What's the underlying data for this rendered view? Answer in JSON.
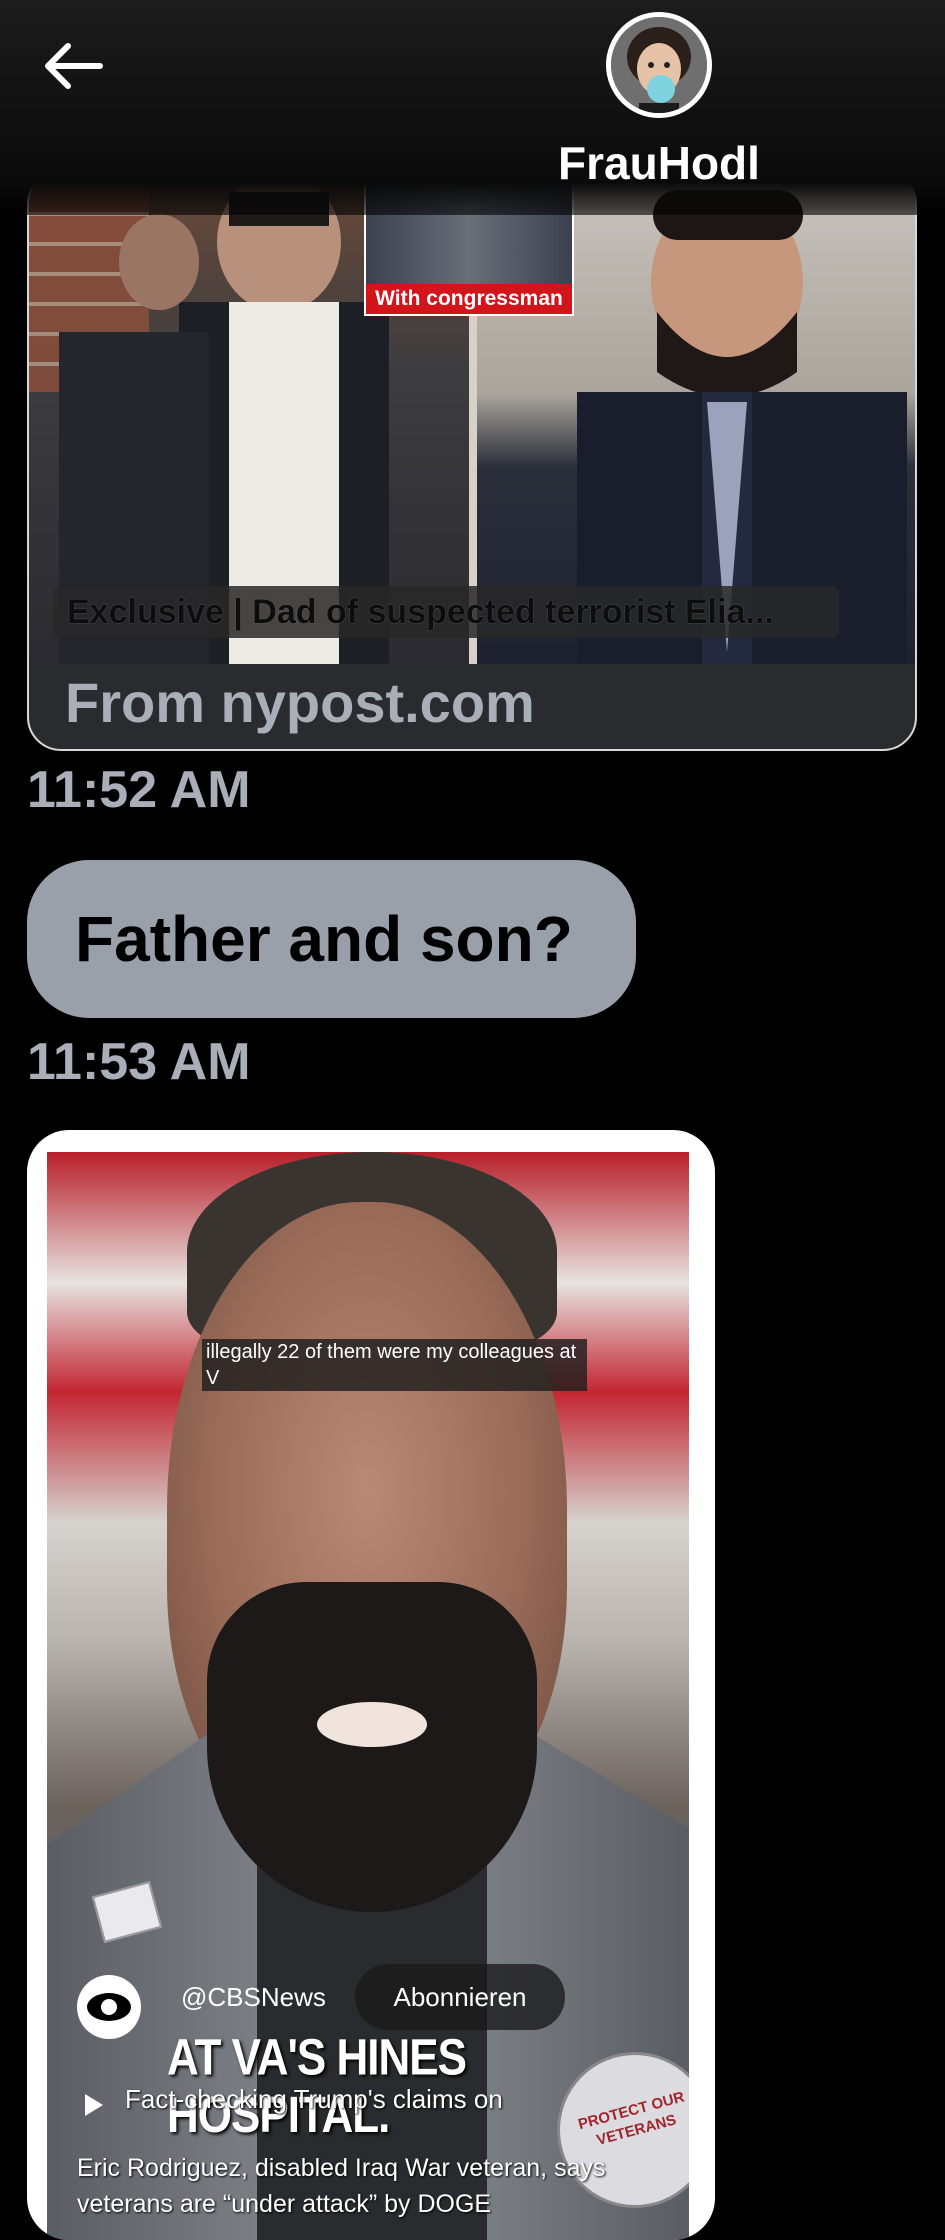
{
  "header": {
    "back_icon": "arrow-left-icon",
    "contact_name": "FrauHodl",
    "avatar_icon": "avatar-cartoon-woman-bubblegum"
  },
  "messages": [
    {
      "type": "link_card",
      "image_label": "With congressman",
      "headline": "Exclusive | Dad of suspected terrorist Elia...",
      "source": "From nypost.com",
      "timestamp": "11:52 AM"
    },
    {
      "type": "text",
      "text": "Father and son?",
      "timestamp": "11:53 AM"
    },
    {
      "type": "video_card",
      "caption": "illegally 22 of them were my colleagues at V",
      "channel": "@CBSNews",
      "subscribe_label": "Abonnieren",
      "banner": "AT VA'S HINES HOSPITAL.",
      "play_text": "Fact-checking Trump's claims on",
      "description": "Eric Rodriguez, disabled Iraq War veteran, says veterans are “under attack” by DOGE",
      "badge_text": "PROTECT OUR VETERANS"
    }
  ]
}
